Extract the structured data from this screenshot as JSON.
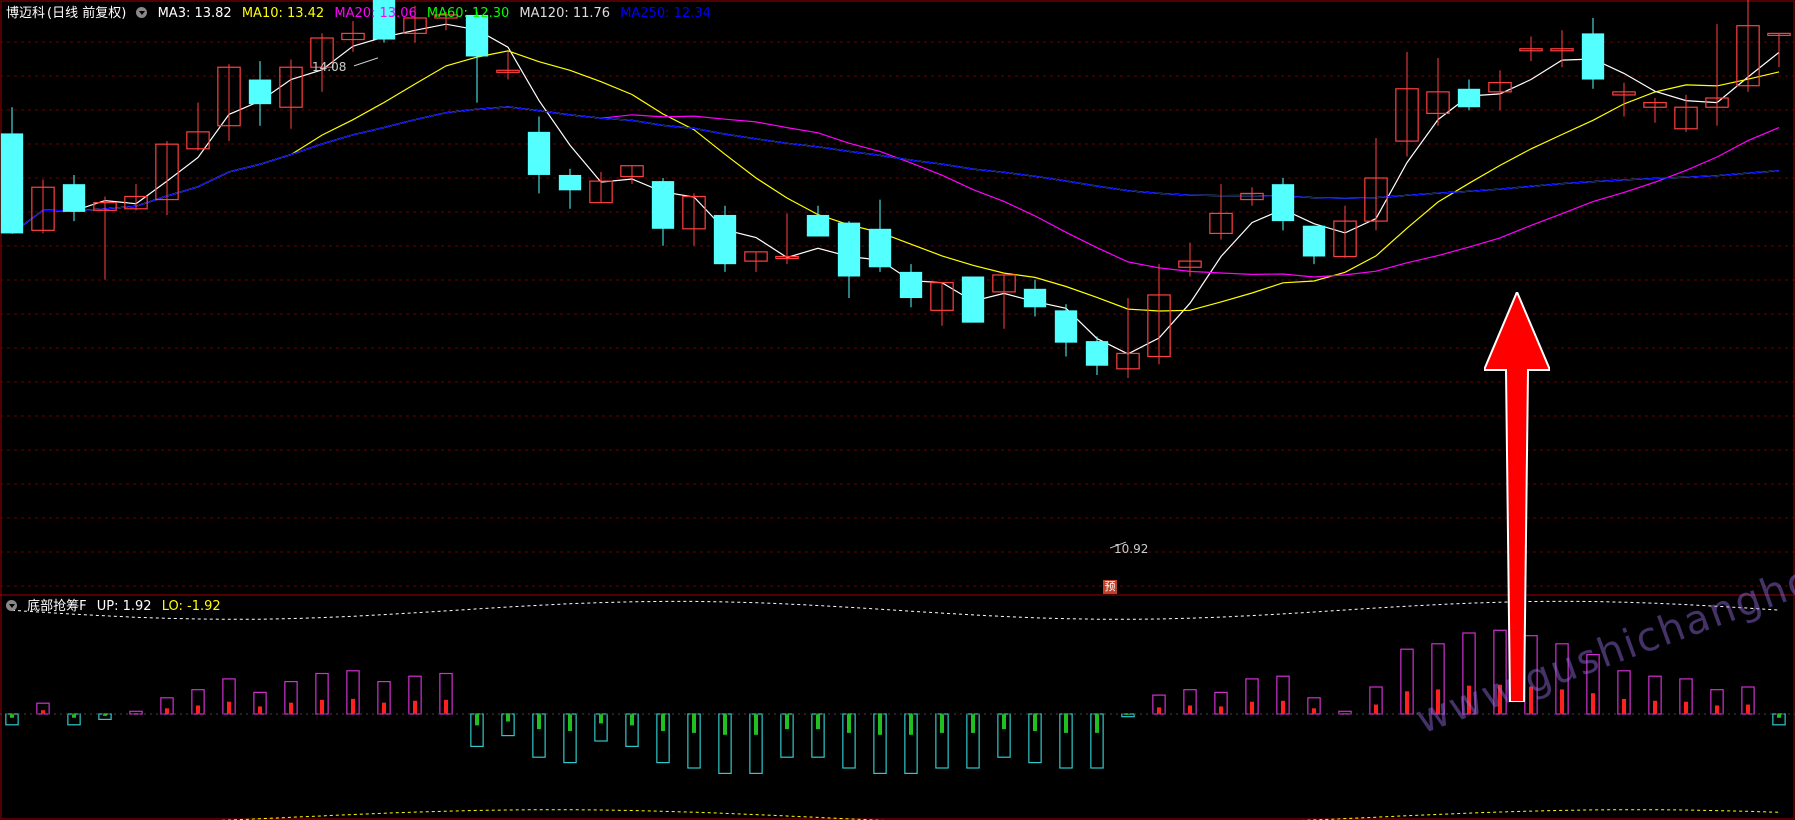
{
  "main_legend": {
    "stock_name": "博迈科",
    "period": "(日线 前复权)",
    "ma_items": [
      {
        "text": "MA3: 13.82",
        "color": "#ffffff"
      },
      {
        "text": "MA10: 13.42",
        "color": "#ffff00"
      },
      {
        "text": "MA20: 13.06",
        "color": "#ff00ff"
      },
      {
        "text": "MA60: 12.30",
        "color": "#00ff00"
      },
      {
        "text": "MA120: 11.76",
        "color": "#dddddd"
      },
      {
        "text": "MA250: 12.34",
        "color": "#0000ff"
      }
    ]
  },
  "sub_legend": {
    "name": "底部抢筹F",
    "up": "UP: 1.92",
    "lo": "LO: -1.92",
    "up_color": "#ffffff",
    "lo_color": "#ffff00"
  },
  "annotations": {
    "high_label": "14.08",
    "low_label": "10.92",
    "forecast_marker": "预"
  },
  "watermark": "www.gushichanghong.com",
  "chart_data": [
    {
      "type": "candlestick",
      "title": "博迈科 (日线 前复权)",
      "ylim": [
        10.55,
        14.3
      ],
      "high": 14.08,
      "low": 10.92,
      "candles": [
        [
          13.55,
          12.9,
          13.72,
          12.9
        ],
        [
          12.92,
          13.2,
          13.25,
          12.9
        ],
        [
          13.22,
          13.04,
          13.28,
          12.98
        ],
        [
          13.05,
          13.1,
          13.14,
          12.6
        ],
        [
          13.06,
          13.14,
          13.22,
          13.05
        ],
        [
          13.12,
          13.48,
          13.5,
          13.02
        ],
        [
          13.45,
          13.56,
          13.75,
          13.44
        ],
        [
          13.6,
          13.98,
          14.0,
          13.5
        ],
        [
          13.9,
          13.74,
          14.02,
          13.6
        ],
        [
          13.72,
          13.98,
          14.03,
          13.58
        ],
        [
          13.98,
          14.17,
          14.2,
          13.82
        ],
        [
          14.16,
          14.2,
          14.28,
          14.08
        ],
        [
          14.5,
          14.16,
          14.62,
          14.14
        ],
        [
          14.2,
          14.3,
          14.38,
          14.14
        ],
        [
          14.3,
          14.32,
          14.34,
          14.22
        ],
        [
          14.32,
          14.05,
          14.34,
          13.75
        ],
        [
          13.95,
          13.96,
          14.08,
          13.9
        ],
        [
          13.56,
          13.28,
          13.66,
          13.16
        ],
        [
          13.28,
          13.18,
          13.32,
          13.06
        ],
        [
          13.1,
          13.24,
          13.3,
          13.1
        ],
        [
          13.27,
          13.34,
          13.3,
          13.22
        ],
        [
          13.24,
          12.93,
          13.26,
          12.82
        ],
        [
          12.93,
          13.14,
          13.16,
          12.82
        ],
        [
          13.02,
          12.7,
          13.08,
          12.65
        ],
        [
          12.72,
          12.78,
          12.7,
          12.65
        ],
        [
          12.75,
          12.75,
          13.03,
          12.7
        ],
        [
          13.02,
          12.88,
          13.08,
          12.9
        ],
        [
          12.97,
          12.62,
          12.98,
          12.48
        ],
        [
          12.93,
          12.68,
          13.12,
          12.65
        ],
        [
          12.65,
          12.48,
          12.7,
          12.42
        ],
        [
          12.4,
          12.58,
          12.52,
          12.3
        ],
        [
          12.62,
          12.32,
          12.6,
          12.36
        ],
        [
          12.52,
          12.63,
          12.6,
          12.28
        ],
        [
          12.54,
          12.42,
          12.6,
          12.36
        ],
        [
          12.4,
          12.19,
          12.44,
          12.1
        ],
        [
          12.2,
          12.04,
          12.23,
          11.98
        ],
        [
          12.02,
          12.12,
          12.48,
          11.96
        ],
        [
          12.1,
          12.5,
          12.7,
          12.05
        ],
        [
          12.68,
          12.72,
          12.84,
          12.62
        ],
        [
          12.9,
          13.03,
          13.22,
          12.86
        ],
        [
          13.12,
          13.16,
          13.2,
          13.08
        ],
        [
          13.22,
          12.98,
          13.26,
          12.92
        ],
        [
          12.95,
          12.75,
          12.95,
          12.7
        ],
        [
          12.75,
          12.98,
          13.08,
          12.74
        ],
        [
          12.98,
          13.26,
          13.52,
          12.92
        ],
        [
          13.5,
          13.84,
          14.08,
          13.4
        ],
        [
          13.68,
          13.82,
          14.04,
          13.6
        ],
        [
          13.84,
          13.72,
          13.9,
          13.7
        ],
        [
          13.82,
          13.88,
          13.96,
          13.7
        ],
        [
          14.1,
          14.1,
          14.18,
          14.02
        ],
        [
          14.1,
          14.1,
          14.22,
          13.98
        ],
        [
          14.2,
          13.9,
          14.3,
          13.84
        ],
        [
          13.8,
          13.82,
          13.88,
          13.66
        ],
        [
          13.72,
          13.75,
          13.78,
          13.62
        ],
        [
          13.58,
          13.72,
          13.8,
          13.56
        ],
        [
          13.72,
          13.78,
          14.26,
          13.6
        ],
        [
          13.86,
          14.25,
          14.48,
          13.82
        ],
        [
          14.2,
          14.2,
          14.08,
          13.98
        ]
      ]
    },
    {
      "type": "bar",
      "title": "底部抢筹F",
      "upper": 1.92,
      "lower": -1.92,
      "values": [
        -0.2,
        0.2,
        -0.2,
        -0.1,
        0.05,
        0.3,
        0.45,
        0.65,
        0.4,
        0.6,
        0.75,
        0.8,
        0.6,
        0.7,
        0.75,
        -0.6,
        -0.4,
        -0.8,
        -0.9,
        -0.5,
        -0.6,
        -0.9,
        -1.0,
        -1.1,
        -1.1,
        -0.8,
        -0.8,
        -1.0,
        -1.1,
        -1.1,
        -1.0,
        -1.0,
        -0.8,
        -0.9,
        -1.0,
        -1.0,
        -0.05,
        0.35,
        0.45,
        0.4,
        0.65,
        0.7,
        0.3,
        0.05,
        0.5,
        1.2,
        1.3,
        1.5,
        1.55,
        1.45,
        1.3,
        1.1,
        0.8,
        0.7,
        0.65,
        0.45,
        0.5,
        -0.2
      ]
    }
  ]
}
